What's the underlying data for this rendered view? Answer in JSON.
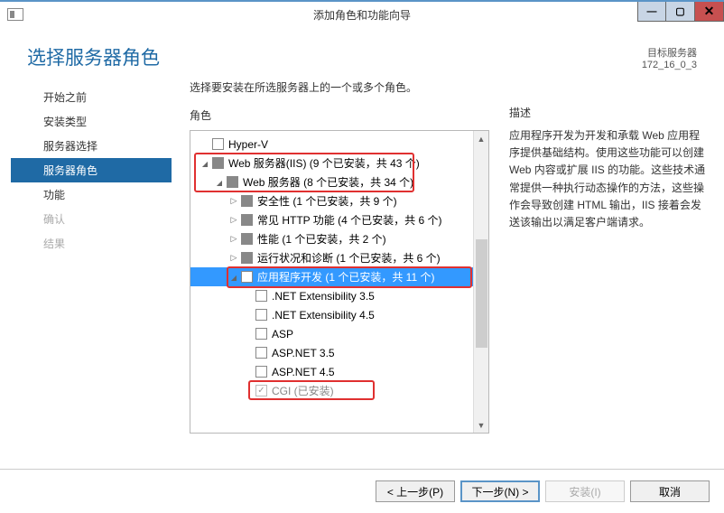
{
  "window": {
    "title": "添加角色和功能向导"
  },
  "header": {
    "title": "选择服务器角色",
    "target_label": "目标服务器",
    "target_value": "172_16_0_3"
  },
  "sidebar": {
    "items": [
      {
        "label": "开始之前"
      },
      {
        "label": "安装类型"
      },
      {
        "label": "服务器选择"
      },
      {
        "label": "服务器角色",
        "active": true
      },
      {
        "label": "功能"
      },
      {
        "label": "确认",
        "disabled": true
      },
      {
        "label": "结果",
        "disabled": true
      }
    ]
  },
  "main": {
    "instruction": "选择要安装在所选服务器上的一个或多个角色。",
    "roles_title": "角色",
    "desc_title": "描述",
    "desc_text": "应用程序开发为开发和承载 Web 应用程序提供基础结构。使用这些功能可以创建 Web 内容或扩展 IIS 的功能。这些技术通常提供一种执行动态操作的方法，这些操作会导致创建 HTML 输出，IIS 接着会发送该输出以满足客户端请求。"
  },
  "tree": [
    {
      "indent": 1,
      "expander": "none",
      "check": "empty",
      "label": "Hyper-V"
    },
    {
      "indent": 1,
      "expander": "open",
      "check": "partial",
      "label": "Web 服务器(IIS) (9 个已安装，共 43 个)"
    },
    {
      "indent": 2,
      "expander": "open",
      "check": "partial",
      "label": "Web 服务器 (8 个已安装，共 34 个)"
    },
    {
      "indent": 3,
      "expander": "closed",
      "check": "partial",
      "label": "安全性 (1 个已安装，共 9 个)"
    },
    {
      "indent": 3,
      "expander": "closed",
      "check": "partial",
      "label": "常见 HTTP 功能 (4 个已安装，共 6 个)"
    },
    {
      "indent": 3,
      "expander": "closed",
      "check": "partial",
      "label": "性能 (1 个已安装，共 2 个)"
    },
    {
      "indent": 3,
      "expander": "closed",
      "check": "partial",
      "label": "运行状况和诊断 (1 个已安装，共 6 个)"
    },
    {
      "indent": 3,
      "expander": "open",
      "check": "empty",
      "label": "应用程序开发 (1 个已安装，共 11 个)",
      "selected": true
    },
    {
      "indent": 4,
      "expander": "none",
      "check": "empty",
      "label": ".NET Extensibility 3.5"
    },
    {
      "indent": 4,
      "expander": "none",
      "check": "empty",
      "label": ".NET Extensibility 4.5"
    },
    {
      "indent": 4,
      "expander": "none",
      "check": "empty",
      "label": "ASP"
    },
    {
      "indent": 4,
      "expander": "none",
      "check": "empty",
      "label": "ASP.NET 3.5"
    },
    {
      "indent": 4,
      "expander": "none",
      "check": "empty",
      "label": "ASP.NET 4.5"
    },
    {
      "indent": 4,
      "expander": "none",
      "check": "checked_disabled",
      "label": "CGI (已安装)",
      "disabled": true
    }
  ],
  "footer": {
    "prev": "< 上一步(P)",
    "next": "下一步(N) >",
    "install": "安装(I)",
    "cancel": "取消"
  }
}
